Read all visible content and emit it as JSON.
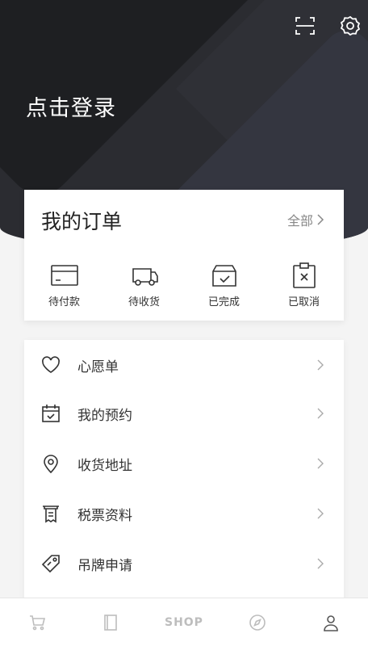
{
  "header": {
    "login_text": "点击登录",
    "icons": [
      "scan-icon",
      "settings-icon"
    ]
  },
  "orders": {
    "title": "我的订单",
    "all_label": "全部",
    "items": [
      {
        "label": "待付款",
        "icon": "card-icon"
      },
      {
        "label": "待收货",
        "icon": "truck-icon"
      },
      {
        "label": "已完成",
        "icon": "box-check-icon"
      },
      {
        "label": "已取消",
        "icon": "clipboard-x-icon"
      }
    ]
  },
  "menu": {
    "items": [
      {
        "label": "心愿单",
        "icon": "heart-icon"
      },
      {
        "label": "我的预约",
        "icon": "calendar-check-icon"
      },
      {
        "label": "收货地址",
        "icon": "location-pin-icon"
      },
      {
        "label": "税票资料",
        "icon": "receipt-icon"
      },
      {
        "label": "吊牌申请",
        "icon": "tag-icon"
      }
    ]
  },
  "bottom_nav": {
    "items": [
      {
        "icon": "cart-icon"
      },
      {
        "icon": "book-icon"
      },
      {
        "label": "SHOP"
      },
      {
        "icon": "compass-icon"
      },
      {
        "icon": "user-icon"
      }
    ]
  },
  "colors": {
    "header_bg": "#2b2c31",
    "card_bg": "#ffffff",
    "page_bg": "#f4f4f4",
    "inactive_nav": "#bdbdbd"
  }
}
